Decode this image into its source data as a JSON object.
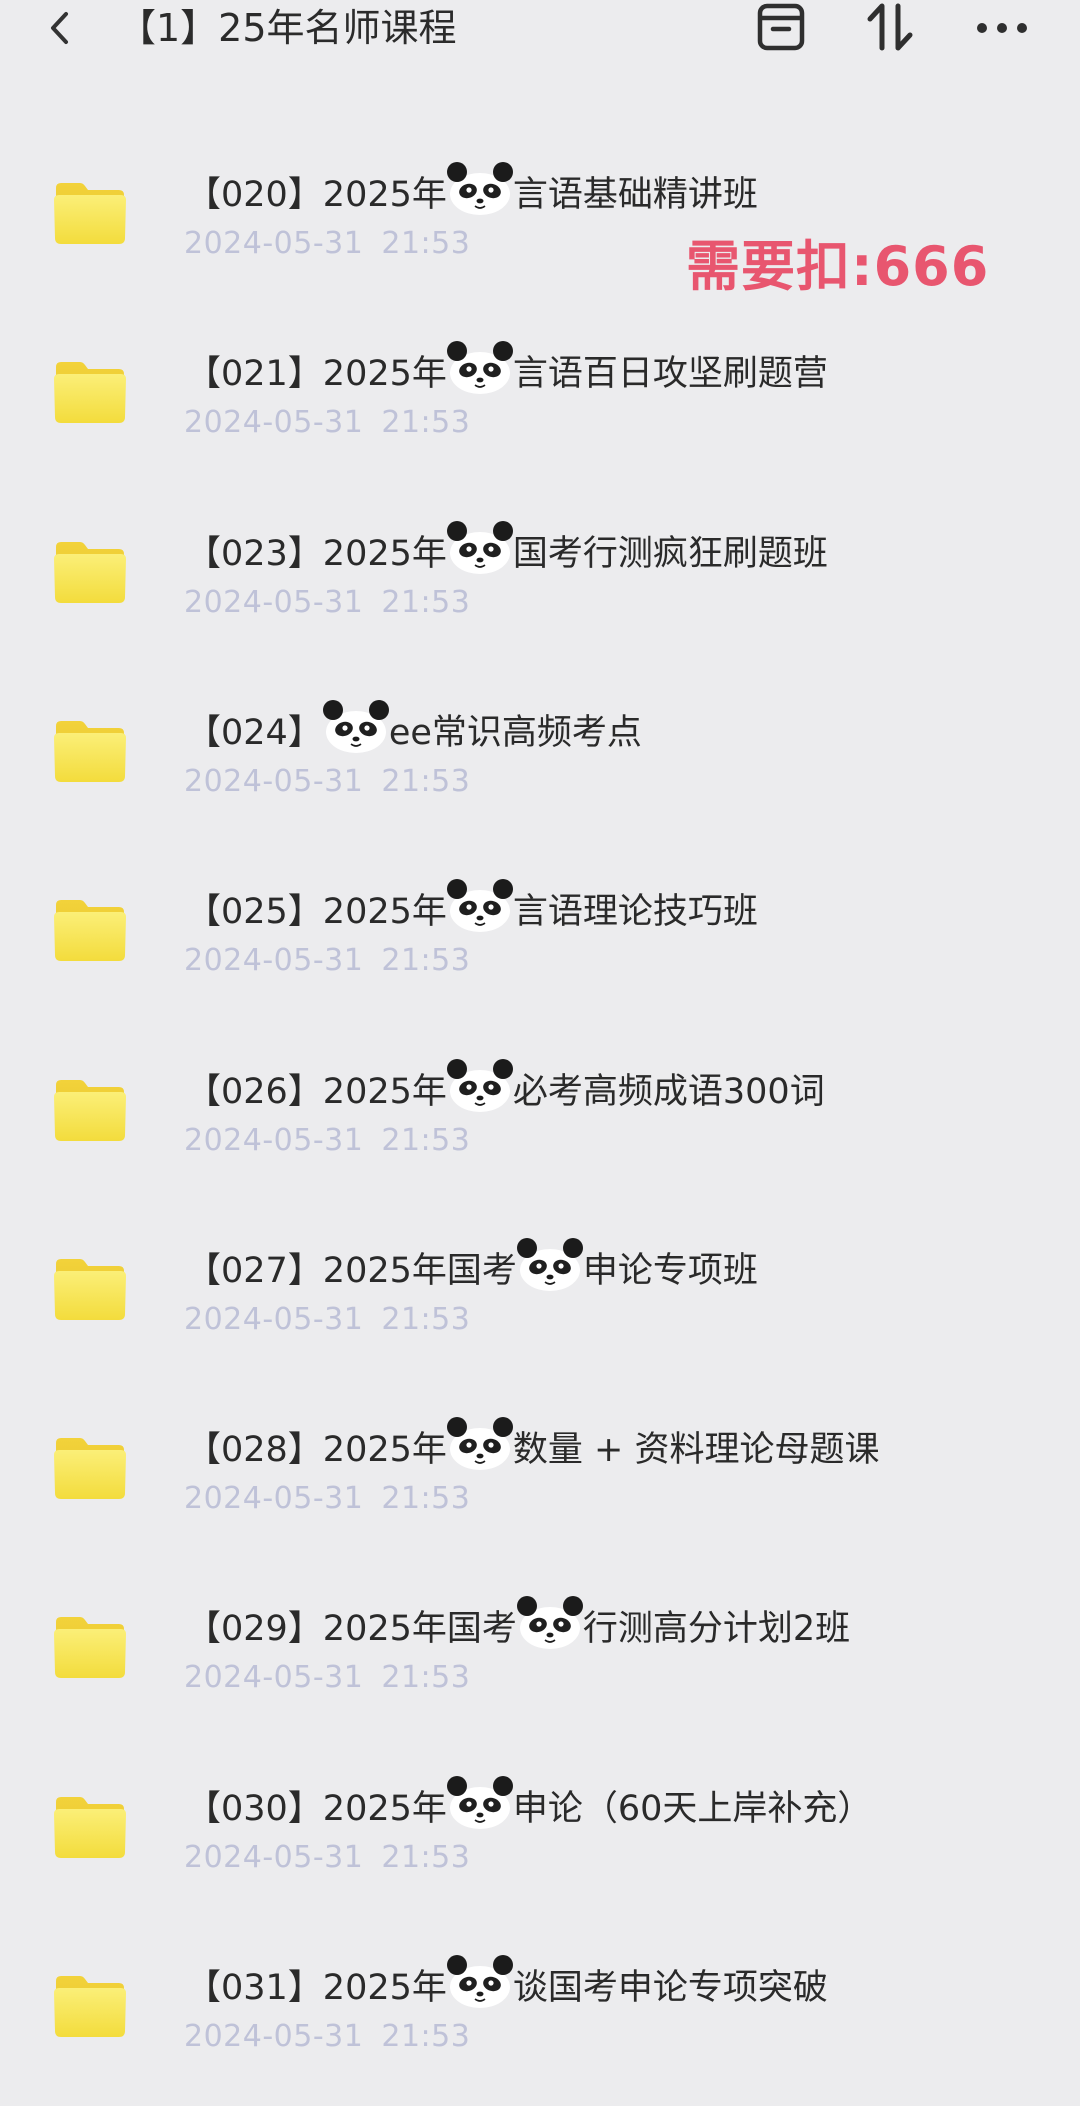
{
  "header": {
    "title": "【1】25年名师课程",
    "back_icon": "chevron-left-icon",
    "actions": [
      "archive-icon",
      "sort-icon",
      "more-icon"
    ]
  },
  "watermark": "需要扣:666",
  "colors": {
    "background": "#ececee",
    "folder": "#f5e14a",
    "date": "#bfc2d8",
    "watermark": "#e8566f"
  },
  "files": [
    {
      "pre": "【020】2025年",
      "post": "言语基础精讲班",
      "date": "2024-05-31",
      "time": "21:53"
    },
    {
      "pre": "【021】2025年",
      "post": "言语百日攻坚刷题营",
      "date": "2024-05-31",
      "time": "21:53"
    },
    {
      "pre": "【023】2025年",
      "post": "国考行测疯狂刷题班",
      "date": "2024-05-31",
      "time": "21:53"
    },
    {
      "pre": "【024】",
      "post": "ee常识高频考点",
      "date": "2024-05-31",
      "time": "21:53"
    },
    {
      "pre": "【025】2025年",
      "post": "言语理论技巧班",
      "date": "2024-05-31",
      "time": "21:53"
    },
    {
      "pre": "【026】2025年",
      "post": "必考高频成语300词",
      "date": "2024-05-31",
      "time": "21:53"
    },
    {
      "pre": "【027】2025年国考",
      "post": "申论专项班",
      "date": "2024-05-31",
      "time": "21:53"
    },
    {
      "pre": "【028】2025年",
      "post": "数量 + 资料理论母题课",
      "date": "2024-05-31",
      "time": "21:53"
    },
    {
      "pre": "【029】2025年国考",
      "post": "行测高分计划2班",
      "date": "2024-05-31",
      "time": "21:53"
    },
    {
      "pre": "【030】2025年",
      "post": "申论（60天上岸补充）",
      "date": "2024-05-31",
      "time": "21:53"
    },
    {
      "pre": "【031】2025年",
      "post": "谈国考申论专项突破",
      "date": "2024-05-31",
      "time": "21:53"
    }
  ]
}
